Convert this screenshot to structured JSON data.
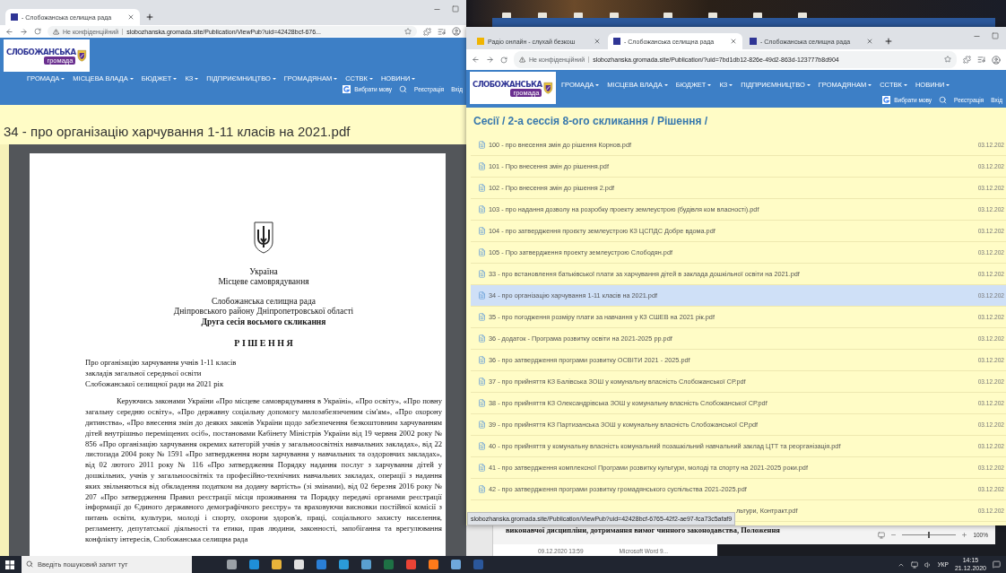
{
  "left_window": {
    "tabs": [
      {
        "title": "- Слобожанська селищна рада",
        "selected": true
      }
    ],
    "address": {
      "security": "Не конфіденційний",
      "url": "slobozhanska.gromada.site/Publication/ViewPub?uid=42428bcf-676..."
    },
    "site_header": {
      "logo_title": "СЛОБОЖАНСЬКА",
      "logo_subtitle": "громада",
      "nav": [
        "ГРОМАДА",
        "МІСЦЕВА ВЛАДА",
        "БЮДЖЕТ",
        "КЗ",
        "ПІДПРИЄМНИЦТВО",
        "ГРОМАДЯНАМ",
        "СCТВК",
        "НОВИНИ"
      ],
      "language_button": "Вибрати мову",
      "register_link": "Реєстрація",
      "login_link": "Вхід"
    },
    "page_title": "34 - про організацію харчування 1-11 класів на 2021.pdf",
    "document": {
      "country": "Україна",
      "subtitle": "Місцеве самоврядування",
      "council": "Слобожанська селищна рада",
      "region": "Дніпровського району Дніпропетровської області",
      "session": "Друга сесія восьмого скликання",
      "decision_heading": "Р І Ш Е Н Н Я",
      "subject_lines": [
        "Про організацію харчування учнів 1-11 класів",
        "закладів загальної середньої освіти",
        "Слобожанської селищної ради на 2021 рік"
      ],
      "body": "Керуючись законами України «Про місцеве самоврядування в Україні», «Про освіту», «Про повну загальну середню освіту», «Про державну соціальну допомогу малозабезпеченим сім'ям», «Про охорону дитинства», «Про внесення змін до деяких законів України щодо забезпечення безкоштовним харчуванням дітей внутрішньо переміщених осіб», постановами Кабінету Міністрів України від 19 червня 2002 року № 856 «Про організацію харчування окремих категорій учнів у загальноосвітніх навчальних закладах», від 22 листопада 2004 року № 1591 «Про затвердження норм харчування у навчальних та оздоровчих закладах», від 02 лютого 2011 року № 116 «Про затвердження Порядку надання послуг з харчування дітей у дошкільних, учнів у загальноосвітніх та професійно-технічних навчальних закладах, операції з надання яких звільняються від обкладення податком на додану вартість» (зі змінами), від 02 березня 2016 року № 207 «Про затвердження Правил реєстрації місця проживання та Порядку передачі органами реєстрації інформації до Єдиного державного демографічного реєстру» та враховуючи висновки постійної комісії з питань освіти, культури, молоді і спорту, охорони здоров'я, праці, соціального захисту населення, регламенту, депутатської діяльності та етики, прав людини, законності, запобігання та врегулювання конфлікту інтересів, Слобожанська селищна рада"
    }
  },
  "right_window": {
    "tabs": [
      {
        "title": "Радіо онлайн - слухай безкош",
        "selected": false
      },
      {
        "title": "- Слобожанська селищна рада",
        "selected": true
      },
      {
        "title": "- Слобожанська селищна рада",
        "selected": false
      }
    ],
    "address": {
      "security": "Не конфіденційний",
      "url": "slobozhanska.gromada.site/Publication/?uid=7bd1db12-826e-49d2-863d-123777b8d904"
    },
    "site_header": {
      "logo_title": "СЛОБОЖАНСЬКА",
      "logo_subtitle": "громада",
      "nav": [
        "ГРОМАДА",
        "МІСЦЕВА ВЛАДА",
        "БЮДЖЕТ",
        "КЗ",
        "ПІДПРИЄМНИЦТВО",
        "ГРОМАДЯНАМ",
        "СCТВК",
        "НОВИНИ"
      ],
      "language_button": "Вибрати мову",
      "register_link": "Реєстрація",
      "login_link": "Вхід"
    },
    "breadcrumb": "Сесії / 2-а сессія 8-ого скликання / Рішення /",
    "files": [
      {
        "name": "100 - про внесення змін до рішення Корнов.pdf",
        "date": "03.12.202",
        "selected": false
      },
      {
        "name": "101 - Про внесення змін до рішення.pdf",
        "date": "03.12.202",
        "selected": false
      },
      {
        "name": "102 - Про внесення змін до рішення 2.pdf",
        "date": "03.12.202",
        "selected": false
      },
      {
        "name": "103 - про надання дозволу на розробку проекту землеустрою (будівля ком власності).pdf",
        "date": "03.12.202",
        "selected": false
      },
      {
        "name": "104 - про затвердження проєкту землеустрою КЗ ЦСПДС Добре вдома.pdf",
        "date": "03.12.202",
        "selected": false
      },
      {
        "name": "105 - Про затвердження проекту землеустрою Слободян.pdf",
        "date": "03.12.202",
        "selected": false
      },
      {
        "name": "33 - про встановлення батьківської плати за харчування дітей в заклада дошкільної освіти на 2021.pdf",
        "date": "03.12.202",
        "selected": false
      },
      {
        "name": "34 - про організацію харчування 1-11 класів на 2021.pdf",
        "date": "03.12.202",
        "selected": true
      },
      {
        "name": "35 - про погодження розміру плати за навчання у КЗ СШЕВ на 2021 рік.pdf",
        "date": "03.12.202",
        "selected": false
      },
      {
        "name": "36 - додаток - Програма розвитку освіти на 2021-2025 рр.pdf",
        "date": "03.12.202",
        "selected": false
      },
      {
        "name": "36 - про затвердження програми розвитку ОСВІТИ 2021 - 2025.pdf",
        "date": "03.12.202",
        "selected": false
      },
      {
        "name": "37 - про прийняття КЗ Балівська ЗОШ у комунальну власність Слобожанської СР.pdf",
        "date": "03.12.202",
        "selected": false
      },
      {
        "name": "38 - про прийняття КЗ Олександрівська ЗОШ у комунальну власність Слобожанської СР.pdf",
        "date": "03.12.202",
        "selected": false
      },
      {
        "name": "39 - про прийняття КЗ Партизанська ЗОШ у комунальну власність Слобожанської СР.pdf",
        "date": "03.12.202",
        "selected": false
      },
      {
        "name": "40 - про прийняття у комунальну власність комунальний позашкільний навчальний заклад ЦТТ та реорганізація.pdf",
        "date": "03.12.202",
        "selected": false
      },
      {
        "name": "41 - про затвердження комплексної Програми розвитку культури, молоді та спорту на 2021-2025 роки.pdf",
        "date": "03.12.202",
        "selected": false
      },
      {
        "name": "42 - про затвердження програми розвитку громадянського суспільства 2021-2025.pdf",
        "date": "03.12.202",
        "selected": false
      },
      {
        "name": "льтури, Контракт.pdf",
        "date": "03.12.202",
        "selected": false,
        "kind": "covered"
      }
    ],
    "status_url": "slobozhanska.gromada.site/Publication/ViewPub?uid=42428bcf-6765-42f2-ae97-fca73c5afaf9"
  },
  "word_window": {
    "partial_text": "виконавчої дисципліни, дотримання вимог чинного законодавства, Положення",
    "zoom": "100%",
    "zoom_slider": {
      "level": 0.5
    },
    "file_date": "09.12.2020 13:59",
    "file_type": "Microsoft Word 9..."
  },
  "taskbar": {
    "search_placeholder": "Введіть пошуковий запит тут",
    "language": "УКР",
    "time": "14:15",
    "date": "21.12.2020"
  }
}
